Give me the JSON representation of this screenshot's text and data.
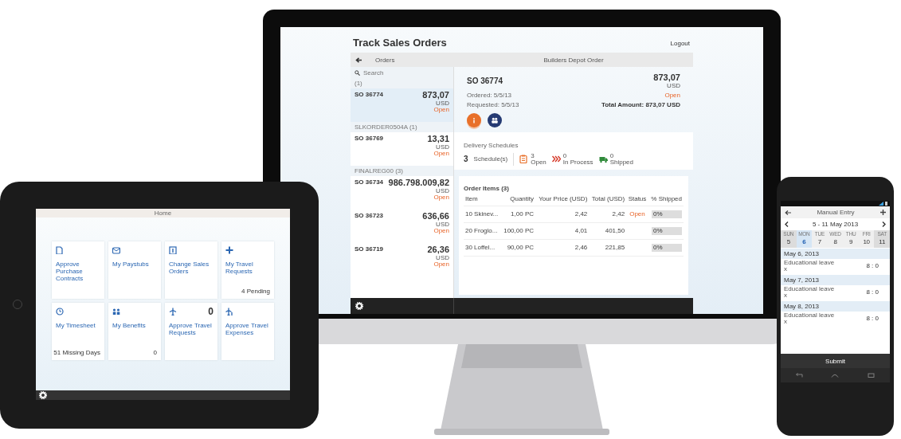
{
  "tablet": {
    "header": "Home",
    "tiles": [
      {
        "kind": "contract",
        "label": "Approve Purchase Contracts"
      },
      {
        "kind": "paystub",
        "label": "My Paystubs"
      },
      {
        "kind": "orders",
        "label": "Change Sales Orders"
      },
      {
        "kind": "plus",
        "label": "My Travel Requests",
        "info": "4 Pending"
      },
      {
        "kind": "timesheet",
        "label": "My Timesheet",
        "info": "51 Missing Days"
      },
      {
        "kind": "benefits",
        "label": "My Benefits",
        "info": "0"
      },
      {
        "kind": "plane",
        "label": "Approve Travel Requests",
        "count": "0"
      },
      {
        "kind": "plane-expense",
        "label": "Approve Travel Expenses"
      }
    ]
  },
  "monitor": {
    "title": "Track Sales Orders",
    "logout": "Logout",
    "list_header": "Orders",
    "search": {
      "placeholder": "Search"
    },
    "groups": [
      {
        "label": "(1)",
        "orders": [
          {
            "number": "SO 36774",
            "amount": "873,07",
            "currency": "USD",
            "status": "Open",
            "selected": true
          }
        ]
      },
      {
        "label": "SLKORDER0504A (1)",
        "orders": [
          {
            "number": "SO 36769",
            "amount": "13,31",
            "currency": "USD",
            "status": "Open",
            "selected": false
          }
        ]
      },
      {
        "label": "FINALREG00 (3)",
        "orders": [
          {
            "number": "SO 36734",
            "amount": "986.798.009,82",
            "currency": "USD",
            "status": "Open",
            "selected": false
          },
          {
            "number": "SO 36723",
            "amount": "636,66",
            "currency": "USD",
            "status": "Open",
            "selected": false
          },
          {
            "number": "SO 36719",
            "amount": "26,36",
            "currency": "USD",
            "status": "Open",
            "selected": false
          }
        ]
      }
    ],
    "detail": {
      "header": "Builders Depot Order",
      "number": "SO 36774",
      "amount": "873,07",
      "currency": "USD",
      "ordered": "Ordered: 5/5/13",
      "requested": "Requested: 5/5/13",
      "status": "Open",
      "total": "Total Amount: 873,07 USD",
      "icon_tabs": [
        {
          "kind": "info",
          "selected": true
        },
        {
          "kind": "people",
          "selected": false
        }
      ],
      "schedules": {
        "title": "Delivery Schedules",
        "count": "3",
        "count_label": "Schedule(s)",
        "items": [
          {
            "kind": "open",
            "count": "3",
            "label": "Open"
          },
          {
            "kind": "in-process",
            "count": "0",
            "label": "In Process"
          },
          {
            "kind": "shipped",
            "count": "0",
            "label": "Shipped"
          }
        ]
      },
      "order_items": {
        "title": "Order Items (3)",
        "columns": [
          "Item",
          "Quantity",
          "Your Price (USD)",
          "Total (USD)",
          "Status",
          "% Shipped"
        ],
        "rows": [
          {
            "item": "10 Skinev...",
            "quantity": "1,00 PC",
            "price": "2,42",
            "total": "2,42",
            "status": "Open",
            "shipped": "0%",
            "level": 0
          },
          {
            "item": "20 Froglo...",
            "quantity": "100,00 PC",
            "price": "4,01",
            "total": "401,50",
            "shipped": "0%",
            "level": 0
          },
          {
            "item": "30 Loffel...",
            "quantity": "90,00 PC",
            "price": "2,46",
            "total": "221,85",
            "shipped": "0%",
            "level": 0
          }
        ]
      }
    }
  },
  "phone": {
    "title": "Manual Entry",
    "week": "5 - 11 May 2013",
    "days": [
      {
        "weekday": "SUN",
        "day": "5",
        "weekend": true,
        "selected": false
      },
      {
        "weekday": "MON",
        "day": "6",
        "weekend": false,
        "selected": true
      },
      {
        "weekday": "TUE",
        "day": "7",
        "weekend": false,
        "selected": false
      },
      {
        "weekday": "WED",
        "day": "8",
        "weekend": false,
        "selected": false
      },
      {
        "weekday": "THU",
        "day": "9",
        "weekend": false,
        "selected": false
      },
      {
        "weekday": "FRI",
        "day": "10",
        "weekend": false,
        "selected": false
      },
      {
        "weekday": "SAT",
        "day": "11",
        "weekend": true,
        "selected": false
      }
    ],
    "entries": [
      {
        "date": "May 6, 2013",
        "type": "Educational leave",
        "note": "x",
        "time": "8 : 0"
      },
      {
        "date": "May 7, 2013",
        "type": "Educational leave",
        "note": "x",
        "time": "8 : 0"
      },
      {
        "date": "May 8, 2013",
        "type": "Educational leave",
        "note": "x",
        "time": "8 : 0"
      }
    ],
    "submit": "Submit"
  }
}
